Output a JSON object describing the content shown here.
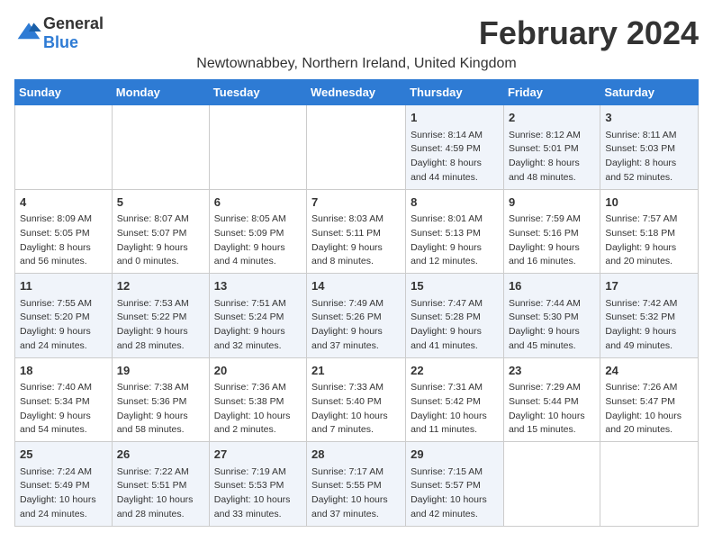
{
  "header": {
    "logo_general": "General",
    "logo_blue": "Blue",
    "month_title": "February 2024",
    "location": "Newtownabbey, Northern Ireland, United Kingdom"
  },
  "columns": [
    "Sunday",
    "Monday",
    "Tuesday",
    "Wednesday",
    "Thursday",
    "Friday",
    "Saturday"
  ],
  "weeks": [
    [
      {
        "day": "",
        "info": ""
      },
      {
        "day": "",
        "info": ""
      },
      {
        "day": "",
        "info": ""
      },
      {
        "day": "",
        "info": ""
      },
      {
        "day": "1",
        "info": "Sunrise: 8:14 AM\nSunset: 4:59 PM\nDaylight: 8 hours and 44 minutes."
      },
      {
        "day": "2",
        "info": "Sunrise: 8:12 AM\nSunset: 5:01 PM\nDaylight: 8 hours and 48 minutes."
      },
      {
        "day": "3",
        "info": "Sunrise: 8:11 AM\nSunset: 5:03 PM\nDaylight: 8 hours and 52 minutes."
      }
    ],
    [
      {
        "day": "4",
        "info": "Sunrise: 8:09 AM\nSunset: 5:05 PM\nDaylight: 8 hours and 56 minutes."
      },
      {
        "day": "5",
        "info": "Sunrise: 8:07 AM\nSunset: 5:07 PM\nDaylight: 9 hours and 0 minutes."
      },
      {
        "day": "6",
        "info": "Sunrise: 8:05 AM\nSunset: 5:09 PM\nDaylight: 9 hours and 4 minutes."
      },
      {
        "day": "7",
        "info": "Sunrise: 8:03 AM\nSunset: 5:11 PM\nDaylight: 9 hours and 8 minutes."
      },
      {
        "day": "8",
        "info": "Sunrise: 8:01 AM\nSunset: 5:13 PM\nDaylight: 9 hours and 12 minutes."
      },
      {
        "day": "9",
        "info": "Sunrise: 7:59 AM\nSunset: 5:16 PM\nDaylight: 9 hours and 16 minutes."
      },
      {
        "day": "10",
        "info": "Sunrise: 7:57 AM\nSunset: 5:18 PM\nDaylight: 9 hours and 20 minutes."
      }
    ],
    [
      {
        "day": "11",
        "info": "Sunrise: 7:55 AM\nSunset: 5:20 PM\nDaylight: 9 hours and 24 minutes."
      },
      {
        "day": "12",
        "info": "Sunrise: 7:53 AM\nSunset: 5:22 PM\nDaylight: 9 hours and 28 minutes."
      },
      {
        "day": "13",
        "info": "Sunrise: 7:51 AM\nSunset: 5:24 PM\nDaylight: 9 hours and 32 minutes."
      },
      {
        "day": "14",
        "info": "Sunrise: 7:49 AM\nSunset: 5:26 PM\nDaylight: 9 hours and 37 minutes."
      },
      {
        "day": "15",
        "info": "Sunrise: 7:47 AM\nSunset: 5:28 PM\nDaylight: 9 hours and 41 minutes."
      },
      {
        "day": "16",
        "info": "Sunrise: 7:44 AM\nSunset: 5:30 PM\nDaylight: 9 hours and 45 minutes."
      },
      {
        "day": "17",
        "info": "Sunrise: 7:42 AM\nSunset: 5:32 PM\nDaylight: 9 hours and 49 minutes."
      }
    ],
    [
      {
        "day": "18",
        "info": "Sunrise: 7:40 AM\nSunset: 5:34 PM\nDaylight: 9 hours and 54 minutes."
      },
      {
        "day": "19",
        "info": "Sunrise: 7:38 AM\nSunset: 5:36 PM\nDaylight: 9 hours and 58 minutes."
      },
      {
        "day": "20",
        "info": "Sunrise: 7:36 AM\nSunset: 5:38 PM\nDaylight: 10 hours and 2 minutes."
      },
      {
        "day": "21",
        "info": "Sunrise: 7:33 AM\nSunset: 5:40 PM\nDaylight: 10 hours and 7 minutes."
      },
      {
        "day": "22",
        "info": "Sunrise: 7:31 AM\nSunset: 5:42 PM\nDaylight: 10 hours and 11 minutes."
      },
      {
        "day": "23",
        "info": "Sunrise: 7:29 AM\nSunset: 5:44 PM\nDaylight: 10 hours and 15 minutes."
      },
      {
        "day": "24",
        "info": "Sunrise: 7:26 AM\nSunset: 5:47 PM\nDaylight: 10 hours and 20 minutes."
      }
    ],
    [
      {
        "day": "25",
        "info": "Sunrise: 7:24 AM\nSunset: 5:49 PM\nDaylight: 10 hours and 24 minutes."
      },
      {
        "day": "26",
        "info": "Sunrise: 7:22 AM\nSunset: 5:51 PM\nDaylight: 10 hours and 28 minutes."
      },
      {
        "day": "27",
        "info": "Sunrise: 7:19 AM\nSunset: 5:53 PM\nDaylight: 10 hours and 33 minutes."
      },
      {
        "day": "28",
        "info": "Sunrise: 7:17 AM\nSunset: 5:55 PM\nDaylight: 10 hours and 37 minutes."
      },
      {
        "day": "29",
        "info": "Sunrise: 7:15 AM\nSunset: 5:57 PM\nDaylight: 10 hours and 42 minutes."
      },
      {
        "day": "",
        "info": ""
      },
      {
        "day": "",
        "info": ""
      }
    ]
  ]
}
